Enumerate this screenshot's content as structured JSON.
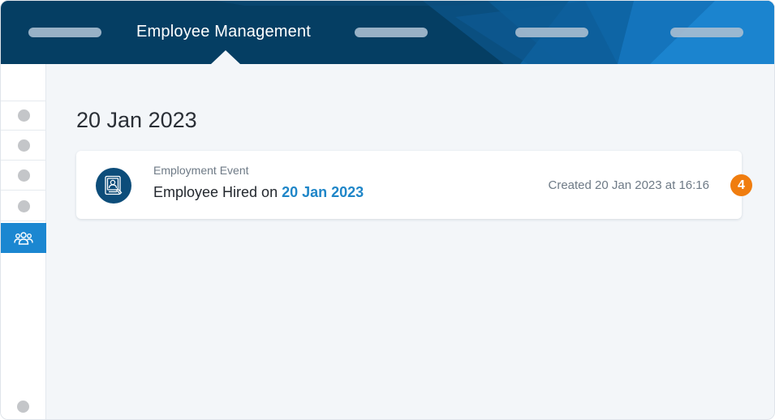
{
  "colors": {
    "header_bg": "#053e63",
    "accent": "#1b87d1",
    "link": "#1f86c8",
    "badge": "#f07d0f",
    "sidebar_dot": "#c4c6c9"
  },
  "header": {
    "title": "Employee Management",
    "active_index": 1
  },
  "sidebar": {
    "items": [
      {
        "icon": "dot-icon",
        "active": false
      },
      {
        "icon": "dot-icon",
        "active": false
      },
      {
        "icon": "dot-icon",
        "active": false
      },
      {
        "icon": "dot-icon",
        "active": false
      },
      {
        "icon": "people-group-icon",
        "active": true
      }
    ],
    "bottom_icon": "dot-icon"
  },
  "main": {
    "date_heading": "20 Jan 2023",
    "event": {
      "icon": "id-card-icon",
      "type": "Employment Event",
      "description_prefix": "Employee Hired on ",
      "description_date": "20 Jan 2023",
      "created": "Created 20 Jan 2023 at 16:16",
      "badge": "4"
    }
  }
}
